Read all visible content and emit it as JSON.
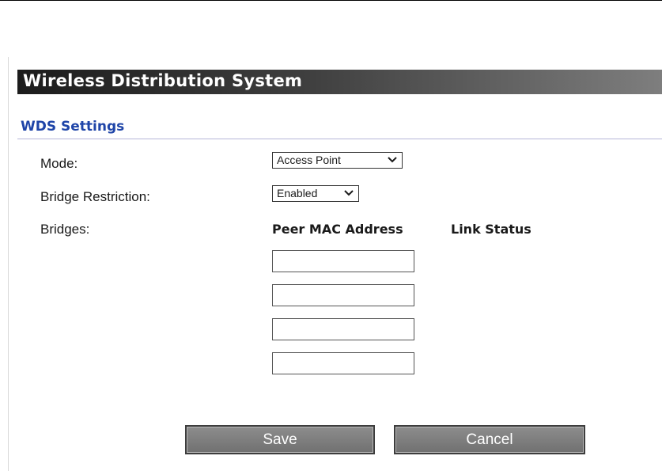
{
  "header": {
    "title": "Wireless Distribution System"
  },
  "section": {
    "title": "WDS Settings"
  },
  "form": {
    "mode_label": "Mode:",
    "mode_value": "Access Point",
    "bridge_restriction_label": "Bridge Restriction:",
    "bridge_restriction_value": "Enabled",
    "bridges_label": "Bridges:",
    "columns": {
      "peer_mac": "Peer MAC Address",
      "link_status": "Link Status"
    },
    "peer_mac_values": [
      "",
      "",
      "",
      ""
    ]
  },
  "buttons": {
    "save": "Save",
    "cancel": "Cancel"
  },
  "colors": {
    "section_title": "#1f45a8",
    "header_bar_dark": "#1c1c1c",
    "header_bar_light": "#7e7e7e",
    "button_fill": "#808080"
  }
}
